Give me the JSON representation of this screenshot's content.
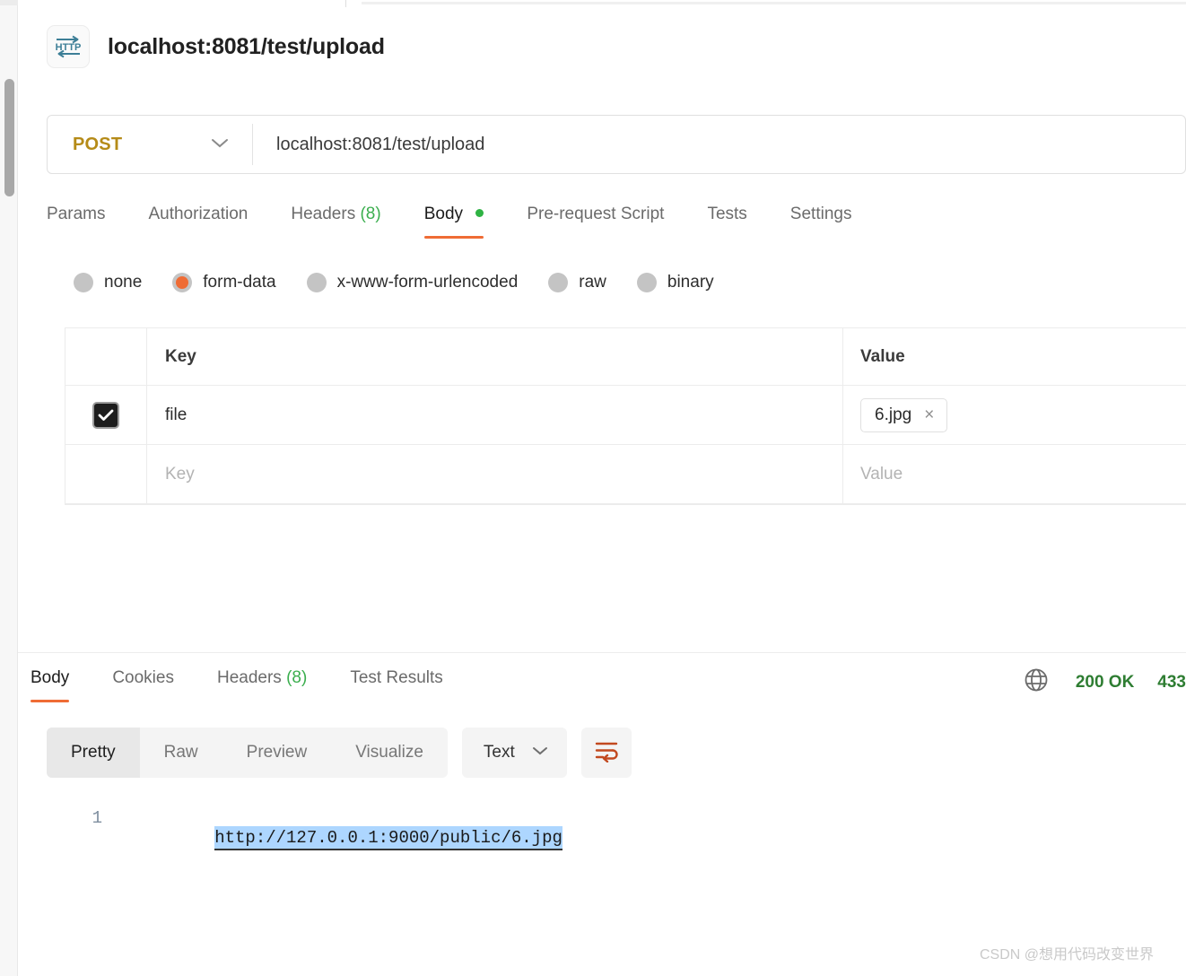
{
  "request": {
    "icon": "http-protocol-icon",
    "title": "localhost:8081/test/upload",
    "method": "POST",
    "url": "localhost:8081/test/upload",
    "tabs": [
      {
        "label": "Params",
        "count": "",
        "active": false,
        "dot": false
      },
      {
        "label": "Authorization",
        "count": "",
        "active": false,
        "dot": false
      },
      {
        "label": "Headers",
        "count": "(8)",
        "active": false,
        "dot": false
      },
      {
        "label": "Body",
        "count": "",
        "active": true,
        "dot": true
      },
      {
        "label": "Pre-request Script",
        "count": "",
        "active": false,
        "dot": false
      },
      {
        "label": "Tests",
        "count": "",
        "active": false,
        "dot": false
      },
      {
        "label": "Settings",
        "count": "",
        "active": false,
        "dot": false
      }
    ],
    "body_types": [
      {
        "label": "none",
        "selected": false
      },
      {
        "label": "form-data",
        "selected": true
      },
      {
        "label": "x-www-form-urlencoded",
        "selected": false
      },
      {
        "label": "raw",
        "selected": false
      },
      {
        "label": "binary",
        "selected": false
      }
    ],
    "table": {
      "headers": {
        "key": "Key",
        "value": "Value"
      },
      "rows": [
        {
          "checked": true,
          "key": "file",
          "value_chip": "6.jpg",
          "chip_remove": "×",
          "is_placeholder": false
        },
        {
          "checked": false,
          "key_placeholder": "Key",
          "value_placeholder": "Value",
          "is_placeholder": true
        }
      ]
    }
  },
  "response": {
    "tabs": [
      {
        "label": "Body",
        "count": "",
        "active": true
      },
      {
        "label": "Cookies",
        "count": "",
        "active": false
      },
      {
        "label": "Headers",
        "count": "(8)",
        "active": false
      },
      {
        "label": "Test Results",
        "count": "",
        "active": false
      }
    ],
    "status_code": "200 OK",
    "size": "433",
    "globe_icon": "globe-icon",
    "format_tabs": [
      {
        "label": "Pretty",
        "active": true
      },
      {
        "label": "Raw",
        "active": false
      },
      {
        "label": "Preview",
        "active": false
      },
      {
        "label": "Visualize",
        "active": false
      }
    ],
    "language": "Text",
    "wrap_icon": "word-wrap-icon",
    "body": {
      "line_number": "1",
      "text": "http://127.0.0.1:9000/public/6.jpg",
      "selected": true
    }
  },
  "watermark": "CSDN @想用代码改变世界",
  "colors": {
    "accent_orange": "#ef6c35",
    "method_post": "#b58b18",
    "status_green": "#2e7d32",
    "count_green": "#3bae4e",
    "selection_blue": "#add6ff"
  }
}
